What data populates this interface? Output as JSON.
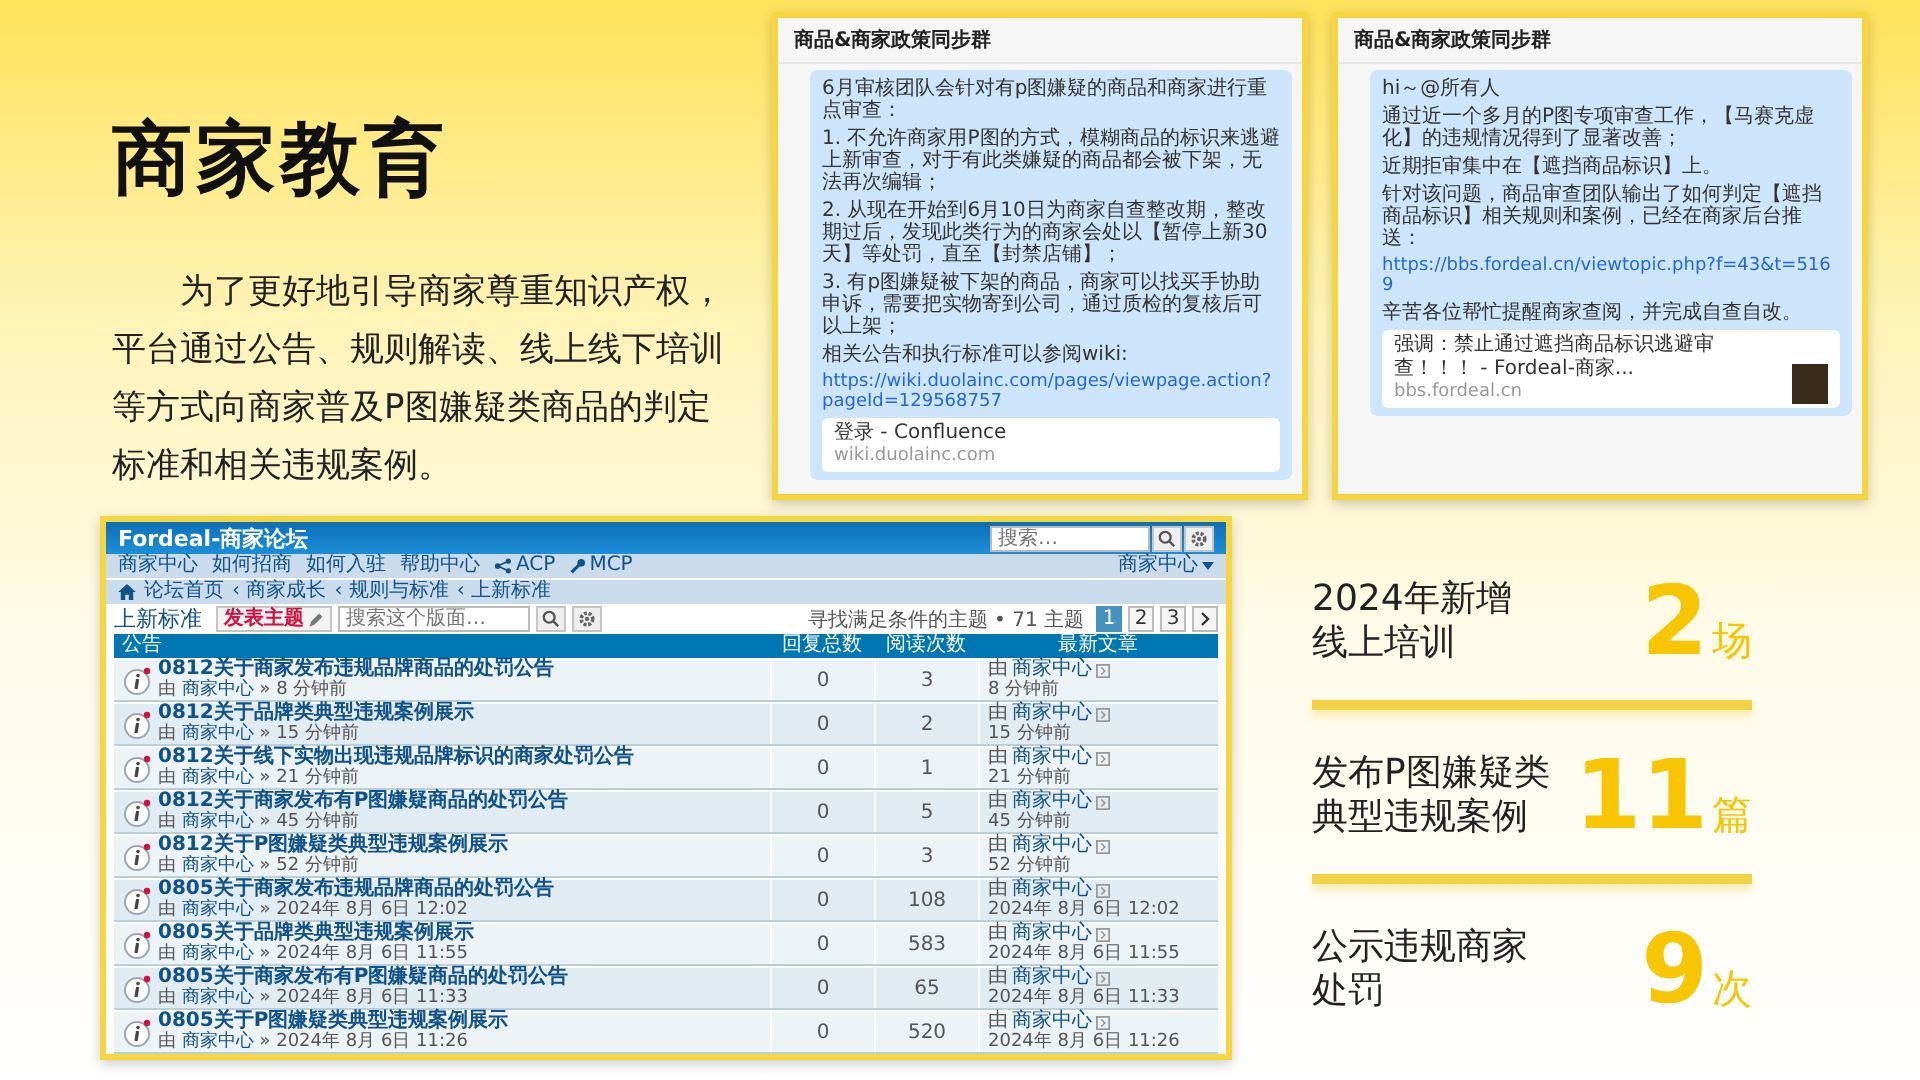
{
  "title": "商家教育",
  "intro": "为了更好地引导商家尊重知识产权，平台通过公告、规则解读、线上线下培训等方式向商家普及P图嫌疑类商品的判定标准和相关违规案例。",
  "chats": [
    {
      "title": "商品&商家政策同步群",
      "blocks": [
        {
          "kind": "text",
          "text": "6月审核团队会针对有p图嫌疑的商品和商家进行重点审查："
        },
        {
          "kind": "text",
          "text": "1. 不允许商家用P图的方式，模糊商品的标识来逃避上新审查，对于有此类嫌疑的商品都会被下架，无法再次编辑；"
        },
        {
          "kind": "text",
          "text": "2. 从现在开始到6月10日为商家自查整改期，整改期过后，发现此类行为的商家会处以【暂停上新30天】等处罚，直至【封禁店铺】；"
        },
        {
          "kind": "text",
          "text": "3. 有p图嫌疑被下架的商品，商家可以找买手协助申诉，需要把实物寄到公司，通过质检的复核后可以上架；"
        },
        {
          "kind": "text",
          "text": "相关公告和执行标准可以参阅wiki:"
        },
        {
          "kind": "link",
          "text": "https://wiki.duolainc.com/pages/viewpage.action?pageId=129568757"
        }
      ],
      "card": {
        "title": "登录 - Confluence",
        "site": "wiki.duolainc.com",
        "image": false
      }
    },
    {
      "title": "商品&商家政策同步群",
      "blocks": [
        {
          "kind": "text",
          "text": "hi～@所有人"
        },
        {
          "kind": "text",
          "text": "通过近一个多月的P图专项审查工作，【马赛克虚化】的违规情况得到了显著改善；"
        },
        {
          "kind": "text",
          "text": "近期拒审集中在【遮挡商品标识】上。"
        },
        {
          "kind": "text",
          "text": "针对该问题，商品审查团队输出了如何判定【遮挡商品标识】相关规则和案例，已经在商家后台推送："
        },
        {
          "kind": "link",
          "text": "https://bbs.fordeal.cn/viewtopic.php?f=43&t=5169"
        },
        {
          "kind": "text",
          "text": "辛苦各位帮忙提醒商家查阅，并完成自查自改。"
        }
      ],
      "card": {
        "title": "强调：禁止通过遮挡商品标识逃避审查！！！ - Fordeal-商家...",
        "site": "bbs.fordeal.cn",
        "image": true
      }
    }
  ],
  "forum": {
    "title": "Fordeal-商家论坛",
    "search_placeholder": "搜索…",
    "nav": [
      "商家中心",
      "如何招商",
      "如何入驻",
      "帮助中心"
    ],
    "nav_icons": [
      "ACP",
      "MCP"
    ],
    "user_menu": "商家中心",
    "breadcrumbs": [
      "论坛首页",
      "‹ 商家成长",
      "‹ 规则与标准",
      "‹ 上新标准"
    ],
    "heading": "上新标准",
    "new_topic": "发表主题",
    "forum_search_placeholder": "搜索这个版面…",
    "topic_count": "寻找满足条件的主题 • 71 主题",
    "pages": [
      {
        "label": "1",
        "selected": true
      },
      {
        "label": "2",
        "selected": false
      },
      {
        "label": "3",
        "selected": false
      }
    ],
    "columns": [
      "公告",
      "回复总数",
      "阅读次数",
      "最新文章"
    ],
    "rows": [
      {
        "title": "0812关于商家发布违规品牌商品的处罚公告",
        "prefix": "由",
        "author": "商家中心",
        "time": "» 8 分钟前",
        "replies": "0",
        "views": "3",
        "last_prefix": "由",
        "last_author": "商家中心",
        "last_time": "8 分钟前"
      },
      {
        "title": "0812关于品牌类典型违规案例展示",
        "prefix": "由",
        "author": "商家中心",
        "time": "» 15 分钟前",
        "replies": "0",
        "views": "2",
        "last_prefix": "由",
        "last_author": "商家中心",
        "last_time": "15 分钟前"
      },
      {
        "title": "0812关于线下实物出现违规品牌标识的商家处罚公告",
        "prefix": "由",
        "author": "商家中心",
        "time": "» 21 分钟前",
        "replies": "0",
        "views": "1",
        "last_prefix": "由",
        "last_author": "商家中心",
        "last_time": "21 分钟前"
      },
      {
        "title": "0812关于商家发布有P图嫌疑商品的处罚公告",
        "prefix": "由",
        "author": "商家中心",
        "time": "» 45 分钟前",
        "replies": "0",
        "views": "5",
        "last_prefix": "由",
        "last_author": "商家中心",
        "last_time": "45 分钟前"
      },
      {
        "title": "0812关于P图嫌疑类典型违规案例展示",
        "prefix": "由",
        "author": "商家中心",
        "time": "» 52 分钟前",
        "replies": "0",
        "views": "3",
        "last_prefix": "由",
        "last_author": "商家中心",
        "last_time": "52 分钟前"
      },
      {
        "title": "0805关于商家发布违规品牌商品的处罚公告",
        "prefix": "由",
        "author": "商家中心",
        "time": "» 2024年 8月 6日 12:02",
        "replies": "0",
        "views": "108",
        "last_prefix": "由",
        "last_author": "商家中心",
        "last_time": "2024年 8月 6日 12:02"
      },
      {
        "title": "0805关于品牌类典型违规案例展示",
        "prefix": "由",
        "author": "商家中心",
        "time": "» 2024年 8月 6日 11:55",
        "replies": "0",
        "views": "583",
        "last_prefix": "由",
        "last_author": "商家中心",
        "last_time": "2024年 8月 6日 11:55"
      },
      {
        "title": "0805关于商家发布有P图嫌疑商品的处罚公告",
        "prefix": "由",
        "author": "商家中心",
        "time": "» 2024年 8月 6日 11:33",
        "replies": "0",
        "views": "65",
        "last_prefix": "由",
        "last_author": "商家中心",
        "last_time": "2024年 8月 6日 11:33"
      },
      {
        "title": "0805关于P图嫌疑类典型违规案例展示",
        "prefix": "由",
        "author": "商家中心",
        "time": "» 2024年 8月 6日 11:26",
        "replies": "0",
        "views": "520",
        "last_prefix": "由",
        "last_author": "商家中心",
        "last_time": "2024年 8月 6日 11:26"
      }
    ]
  },
  "stats": [
    {
      "label_lines": [
        "2024年新增",
        "线上培训"
      ],
      "value": "2",
      "unit": "场"
    },
    {
      "label_lines": [
        "发布P图嫌疑类",
        "典型违规案例"
      ],
      "value": "11",
      "unit": "篇"
    },
    {
      "label_lines": [
        "公示违规商家",
        "处罚"
      ],
      "value": "9",
      "unit": "次"
    }
  ]
}
